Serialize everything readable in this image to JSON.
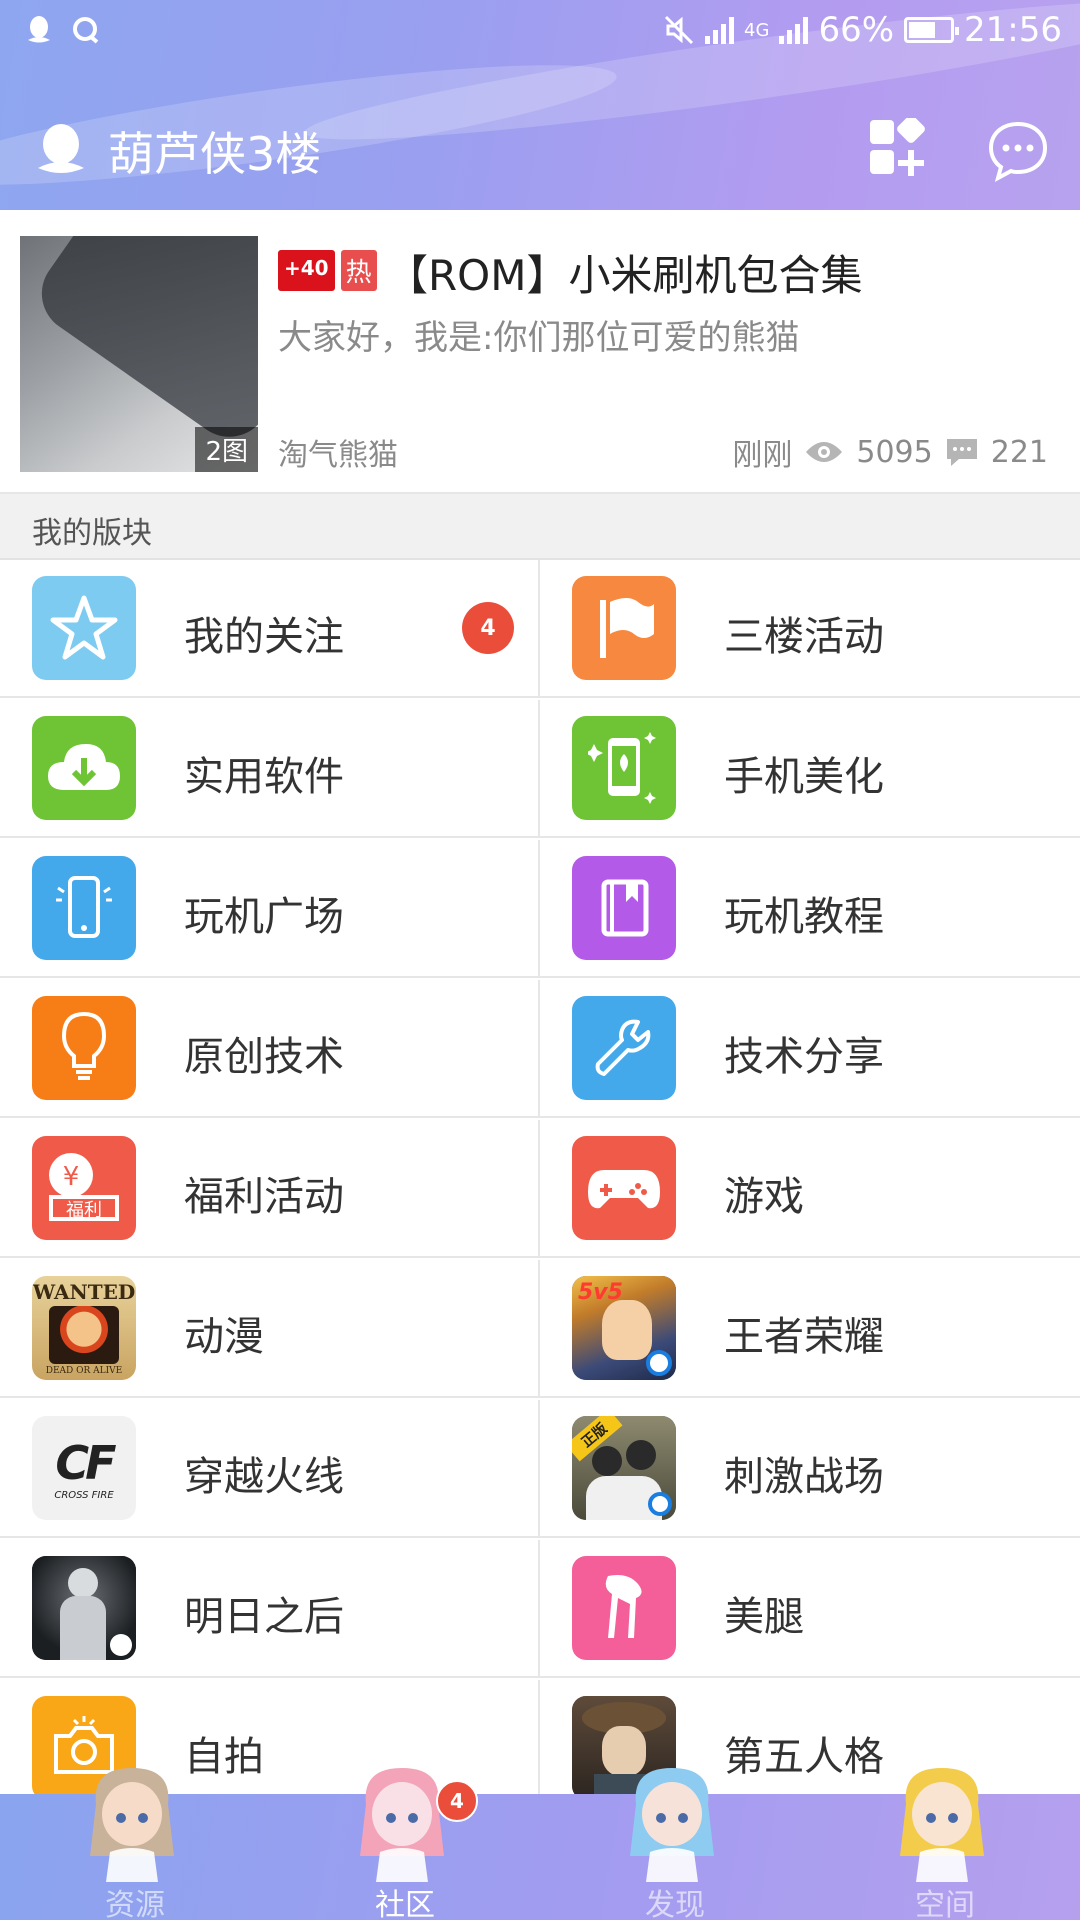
{
  "status_bar": {
    "network": "4G",
    "battery": "66%",
    "battery_level": 0.66,
    "time": "21:56",
    "left_icons": [
      "qq-penguin-icon",
      "qzone-icon"
    ]
  },
  "header": {
    "title": "葫芦侠3楼",
    "actions": [
      "add-block-icon",
      "message-icon"
    ]
  },
  "featured_post": {
    "tag_plus": "+40",
    "tag_hot": "热",
    "title": "【ROM】小米刷机包合集",
    "subtitle": "大家好，我是:你们那位可爱的熊猫",
    "thumb_count": "2图",
    "author": "淘气熊猫",
    "time": "刚刚",
    "views": "5095",
    "comments": "221"
  },
  "section": {
    "label": "我的版块"
  },
  "blocks": [
    {
      "label": "我的关注",
      "badge": "4",
      "icon": "star-icon",
      "color": "#7ecbf1"
    },
    {
      "label": "三楼活动",
      "icon": "flag-icon",
      "color": "#f7883f"
    },
    {
      "label": "实用软件",
      "icon": "cloud-download-icon",
      "color": "#6fc436"
    },
    {
      "label": "手机美化",
      "icon": "phone-flower-icon",
      "color": "#6fc436"
    },
    {
      "label": "玩机广场",
      "icon": "phone-icon",
      "color": "#44a9ea"
    },
    {
      "label": "玩机教程",
      "icon": "book-icon",
      "color": "#b45ae8"
    },
    {
      "label": "原创技术",
      "icon": "bulb-icon",
      "color": "#f77e16"
    },
    {
      "label": "技术分享",
      "icon": "wrench-icon",
      "color": "#44a9ea"
    },
    {
      "label": "福利活动",
      "icon": "welfare-icon",
      "color": "#f05a48",
      "icon_text": "福利"
    },
    {
      "label": "游戏",
      "icon": "gamepad-icon",
      "color": "#f05a48"
    },
    {
      "label": "动漫",
      "icon": "wanted-poster-icon",
      "color": "#c49a58",
      "icon_text": "WANTED"
    },
    {
      "label": "王者荣耀",
      "icon": "honor-of-kings-icon",
      "color": "#3b4a78",
      "icon_text": "5v5"
    },
    {
      "label": "穿越火线",
      "icon": "crossfire-icon",
      "color": "#e9e9e9",
      "icon_text": "CF"
    },
    {
      "label": "刺激战场",
      "icon": "pubg-icon",
      "color": "#6a6a5a",
      "icon_text": "正版"
    },
    {
      "label": "明日之后",
      "icon": "lifeafter-icon",
      "color": "#2b2f33"
    },
    {
      "label": "美腿",
      "icon": "legs-icon",
      "color": "#f45f9a"
    },
    {
      "label": "自拍",
      "icon": "camera-icon",
      "color": "#f9a716"
    },
    {
      "label": "第五人格",
      "icon": "identity-v-icon",
      "color": "#7d6a55"
    }
  ],
  "bottom_nav": [
    {
      "label": "资源",
      "icon": "cat-girl-avatar-icon",
      "active": false
    },
    {
      "label": "社区",
      "icon": "pink-hair-avatar-icon",
      "active": true,
      "badge": "4"
    },
    {
      "label": "发现",
      "icon": "blue-hair-avatar-icon",
      "active": false
    },
    {
      "label": "空间",
      "icon": "blonde-avatar-icon",
      "active": false
    }
  ]
}
